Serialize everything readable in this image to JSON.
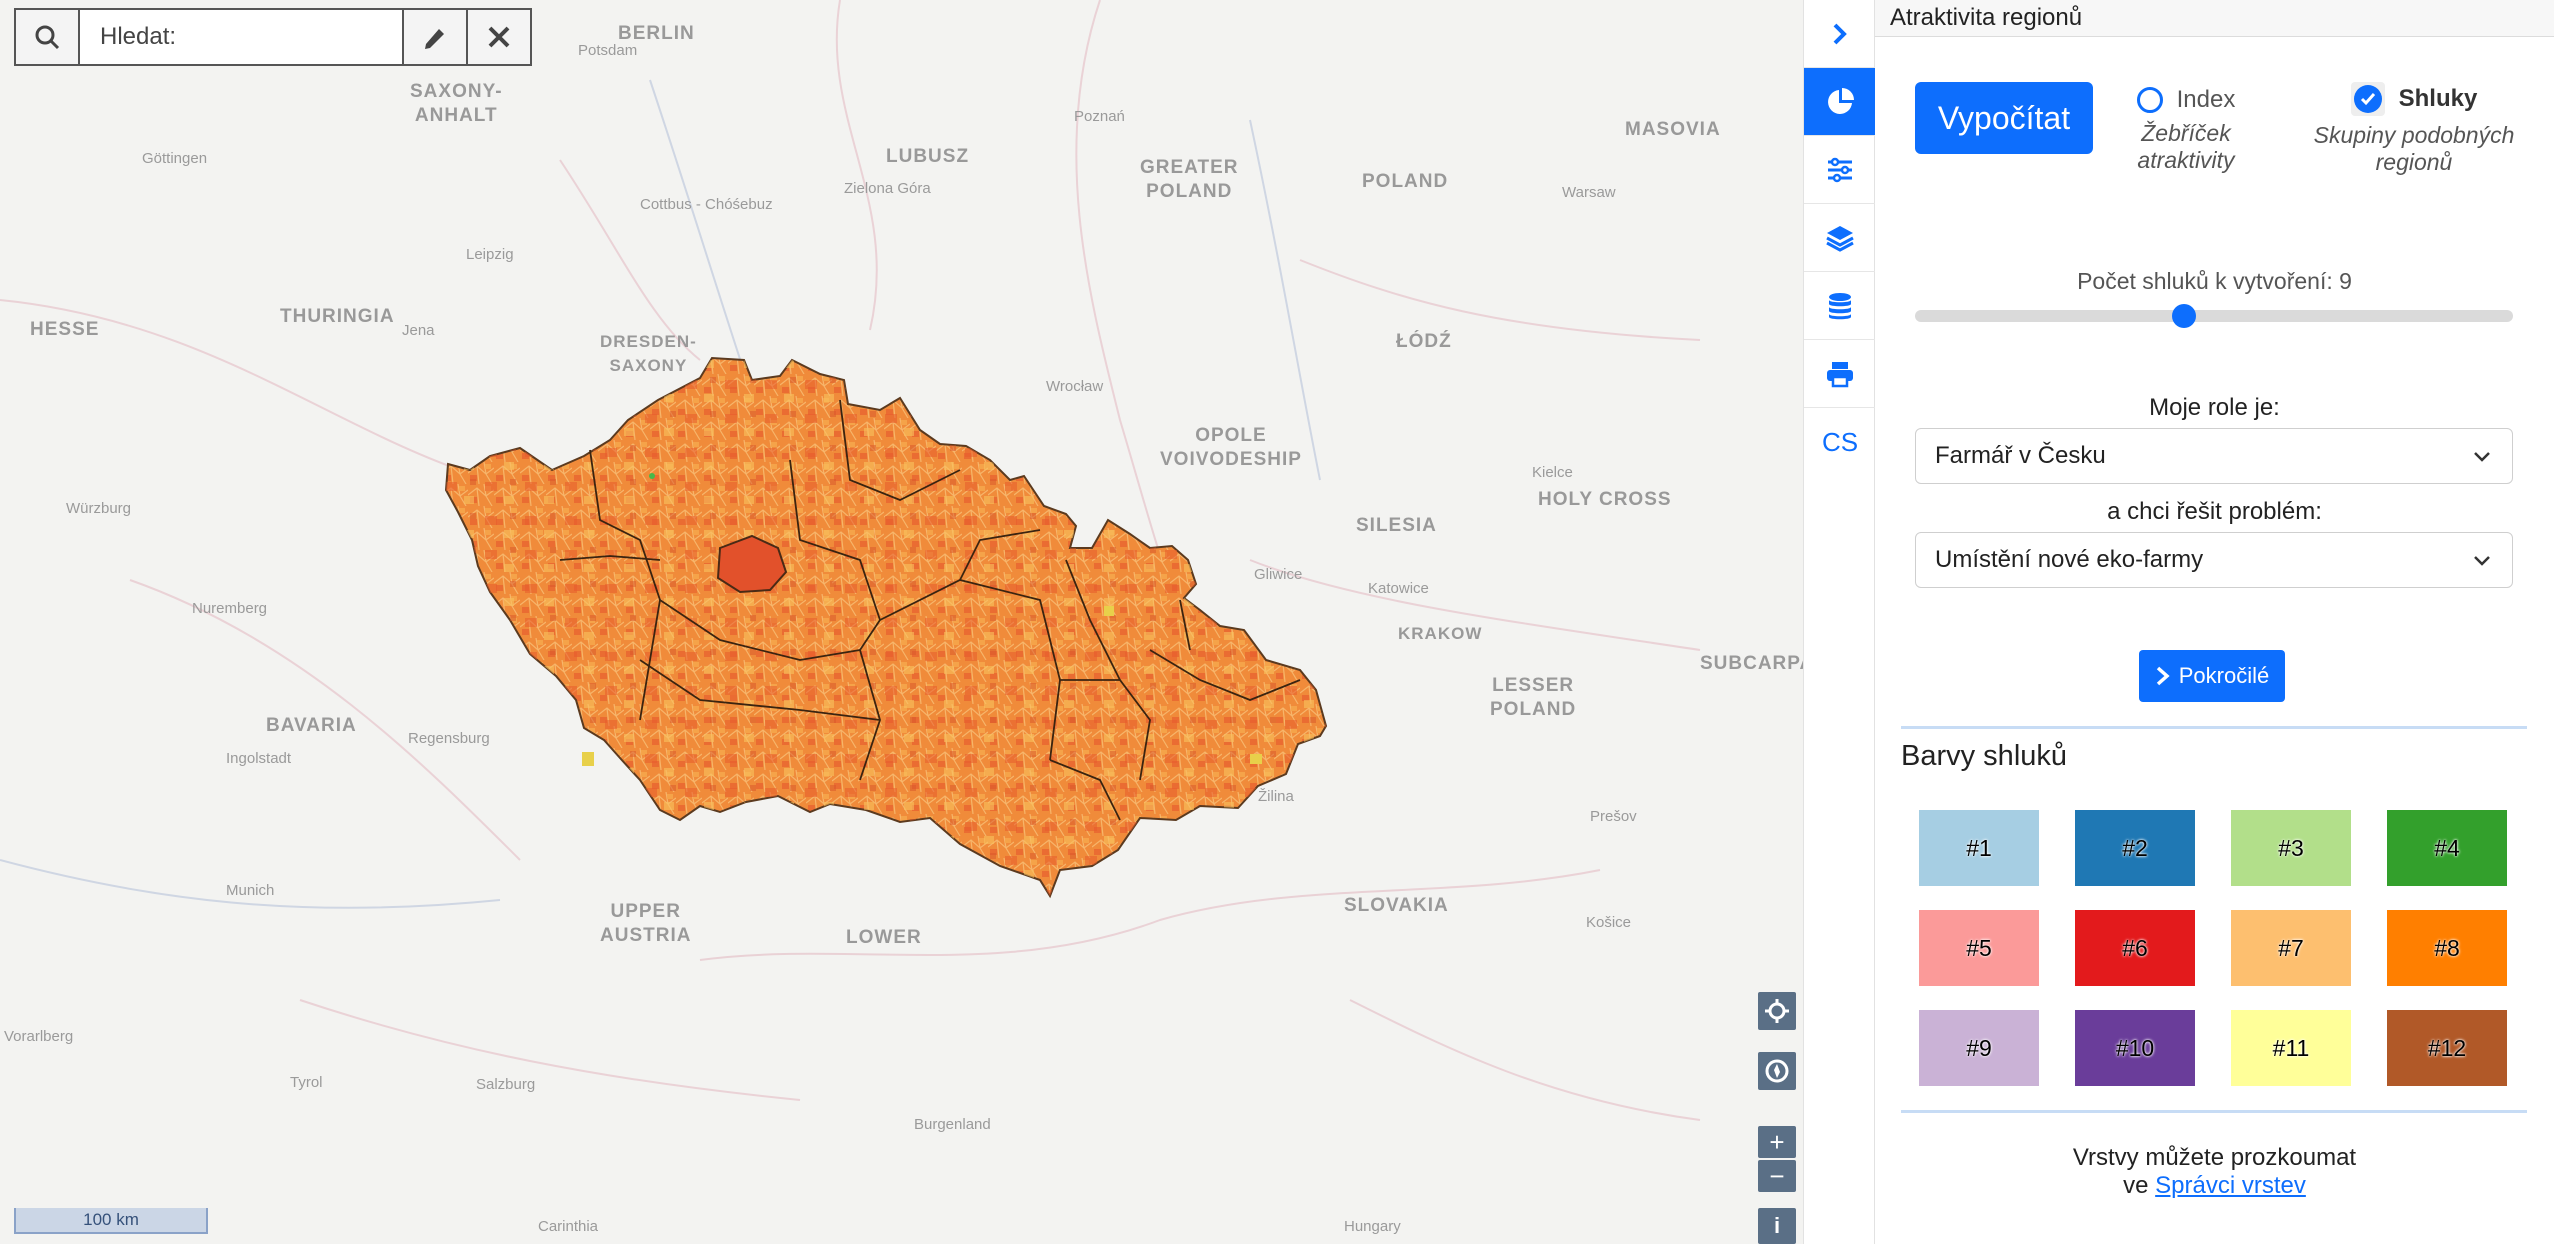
{
  "search": {
    "placeholder": "Hledat:"
  },
  "map": {
    "scale_label": "100 km",
    "region_labels": [
      {
        "text": "BERLIN"
      },
      {
        "text": "SAXONY-\nANHALT"
      },
      {
        "text": "LUBUSZ"
      },
      {
        "text": "GREATER\nPOLAND"
      },
      {
        "text": "MASOVIA"
      },
      {
        "text": "POLAND"
      },
      {
        "text": "HESSE"
      },
      {
        "text": "THURINGIA"
      },
      {
        "text": "DRESDEN-\nSAXONY"
      },
      {
        "text": "ŁÓDŹ"
      },
      {
        "text": "OPOLE\nVOIVODESHIP"
      },
      {
        "text": "HOLY CROSS"
      },
      {
        "text": "SILESIA"
      },
      {
        "text": "LESSER\nPOLAND"
      },
      {
        "text": "SUBCARPA"
      },
      {
        "text": "BAVARIA"
      },
      {
        "text": "SLOVAKIA"
      },
      {
        "text": "UPPER\nAUSTRIA"
      },
      {
        "text": "LOWER"
      },
      {
        "text": "KRAKOW"
      }
    ],
    "city_labels": [
      {
        "text": "Potsdam"
      },
      {
        "text": "Poznań"
      },
      {
        "text": "Göttingen"
      },
      {
        "text": "Cottbus - Chóśebuz"
      },
      {
        "text": "Zielona Góra"
      },
      {
        "text": "Warsaw"
      },
      {
        "text": "Leipzig"
      },
      {
        "text": "Jena"
      },
      {
        "text": "Wrocław"
      },
      {
        "text": "Kielce"
      },
      {
        "text": "Würzburg"
      },
      {
        "text": "Gliwice"
      },
      {
        "text": "Katowice"
      },
      {
        "text": "Nuremberg"
      },
      {
        "text": "Regensburg"
      },
      {
        "text": "Ingolstadt"
      },
      {
        "text": "Munich"
      },
      {
        "text": "Žilina"
      },
      {
        "text": "Prešov"
      },
      {
        "text": "Košice"
      },
      {
        "text": "Salzburg"
      },
      {
        "text": "Tyrol"
      },
      {
        "text": "Burgenland"
      },
      {
        "text": "Hungary"
      },
      {
        "text": "Carinthia"
      },
      {
        "text": "Vorarlberg"
      }
    ]
  },
  "strip": {
    "lang": "CS"
  },
  "panel": {
    "title": "Atraktivita regionů",
    "calc_button": "Vypočítat",
    "mode_index": {
      "label": "Index",
      "sub": "Žebříček atraktivity",
      "selected": false
    },
    "mode_clusters": {
      "label": "Shluky",
      "sub": "Skupiny podobných regionů",
      "selected": true
    },
    "slider_label": "Počet shluků k vytvoření: 9",
    "slider_value": 9,
    "slider_max": 20,
    "role_label": "Moje role je:",
    "role_value": "Farmář v Česku",
    "problem_label": "a chci řešit problém:",
    "problem_value": "Umístění nové eko-farmy",
    "advanced_button": "Pokročilé",
    "colors_title": "Barvy shluků",
    "clusters": [
      {
        "label": "#1",
        "color": "#a6cee3"
      },
      {
        "label": "#2",
        "color": "#1f78b4"
      },
      {
        "label": "#3",
        "color": "#b2df8a"
      },
      {
        "label": "#4",
        "color": "#33a02c"
      },
      {
        "label": "#5",
        "color": "#fb9a99"
      },
      {
        "label": "#6",
        "color": "#e31a1c"
      },
      {
        "label": "#7",
        "color": "#fdbf6f"
      },
      {
        "label": "#8",
        "color": "#ff7f00"
      },
      {
        "label": "#9",
        "color": "#cab2d6"
      },
      {
        "label": "#10",
        "color": "#6a3d9a"
      },
      {
        "label": "#11",
        "color": "#ffff99"
      },
      {
        "label": "#12",
        "color": "#b15928"
      }
    ],
    "footer_text": "Vrstvy můžete prozkoumat",
    "footer_prefix": "ve",
    "footer_link": "Správci vrstev"
  }
}
